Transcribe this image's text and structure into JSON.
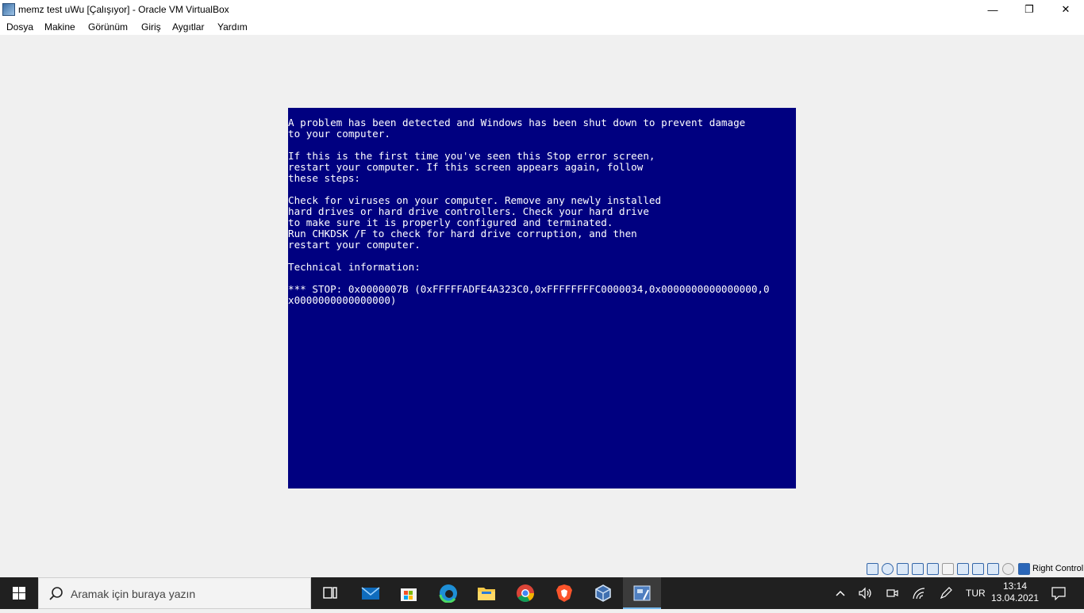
{
  "window": {
    "title": "memz test uWu [Çalışıyor] - Oracle VM VirtualBox",
    "minimize_glyph": "—",
    "restore_glyph": "❐",
    "close_glyph": "✕"
  },
  "menu": [
    "Dosya",
    "Makine",
    "Görünüm",
    "Giriş",
    "Aygıtlar",
    "Yardım"
  ],
  "bsod": {
    "lines": [
      "A problem has been detected and Windows has been shut down to prevent damage",
      "to your computer.",
      "",
      "If this is the first time you've seen this Stop error screen,",
      "restart your computer. If this screen appears again, follow",
      "these steps:",
      "",
      "Check for viruses on your computer. Remove any newly installed",
      "hard drives or hard drive controllers. Check your hard drive",
      "to make sure it is properly configured and terminated.",
      "Run CHKDSK /F to check for hard drive corruption, and then",
      "restart your computer.",
      "",
      "Technical information:",
      "",
      "*** STOP: 0x0000007B (0xFFFFFADFE4A323C0,0xFFFFFFFFC0000034,0x0000000000000000,0",
      "x0000000000000000)"
    ]
  },
  "statusbar": {
    "icons": [
      "hard-disk-icon",
      "optical-drive-icon",
      "audio-icon",
      "network-icon",
      "usb-icon",
      "shared-folder-icon",
      "display-icon",
      "recording-icon",
      "cpu-icon",
      "mouse-integration-icon",
      "host-key-arrow-icon"
    ],
    "host_key": "Right Control"
  },
  "taskbar": {
    "search_placeholder": "Aramak için buraya yazın",
    "apps": [
      "task-view",
      "mail",
      "microsoft-store",
      "edge",
      "file-explorer",
      "chrome",
      "brave",
      "virtualbox",
      "virtualbox-vm"
    ],
    "language": "TUR",
    "time": "13:14",
    "date": "13.04.2021"
  },
  "colors": {
    "bsod_bg": "#000080",
    "bsod_text": "#ffffff",
    "taskbar_bg": "#202020",
    "active_underline": "#76b9ed"
  }
}
